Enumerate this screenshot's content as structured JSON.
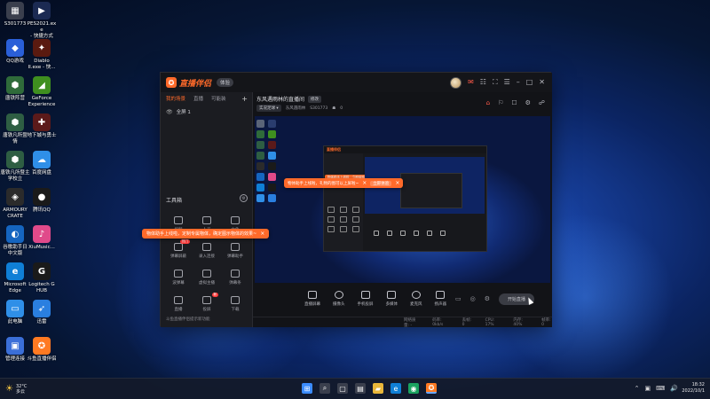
{
  "desktop": {
    "icons": [
      {
        "label": "S301773",
        "color": "#3a3f4d",
        "glyph": "▦"
      },
      {
        "label": "PES2021.exe\n- 快捷方式",
        "color": "#1b2a52",
        "glyph": "▶"
      },
      {
        "label": "QQ游戏",
        "color": "#2a5fd8",
        "glyph": "◆"
      },
      {
        "label": "Diablo\nII.exe - 快...",
        "color": "#5a1a10",
        "glyph": "✦"
      },
      {
        "label": "唐铁阵营",
        "color": "#2f6b3a",
        "glyph": "⬢"
      },
      {
        "label": "GeForce\nExperience",
        "color": "#3f8f1f",
        "glyph": "◢"
      },
      {
        "label": "唐铁凡所暨\n情",
        "color": "#2e5e43",
        "glyph": "⬢"
      },
      {
        "label": "地下城与勇士",
        "color": "#5b1a1a",
        "glyph": "✚"
      },
      {
        "label": "唐铁凡所暨主\n学校立",
        "color": "#2e5e43",
        "glyph": "⬢"
      },
      {
        "label": "百度网盘",
        "color": "#2f8fe8",
        "glyph": "☁"
      },
      {
        "label": "ARMOURY\nCRATE",
        "color": "#2b2b2b",
        "glyph": "◈"
      },
      {
        "label": "腾讯QQ",
        "color": "#1a1a1a",
        "glyph": "●"
      },
      {
        "label": "谷歌助手日\n中文版",
        "color": "#1565c0",
        "glyph": "◐"
      },
      {
        "label": "XiuMusic...",
        "color": "#e04a8a",
        "glyph": "♪"
      },
      {
        "label": "Microsoft\nEdge",
        "color": "#0f7fd6",
        "glyph": "e"
      },
      {
        "label": "Logitech G\nHUB",
        "color": "#1a1a1a",
        "glyph": "G"
      },
      {
        "label": "此电脑",
        "color": "#2f8fe8",
        "glyph": "▭"
      },
      {
        "label": "迅雷",
        "color": "#2a7fe0",
        "glyph": "➶"
      },
      {
        "label": "管理连接",
        "color": "#3b6fd8",
        "glyph": "▣"
      },
      {
        "label": "斗鱼直播伴侣",
        "color": "#ff7a22",
        "glyph": "✪"
      }
    ]
  },
  "app": {
    "logo_text": "直播伴侣",
    "version_badge": "体验",
    "title_icons": [
      "✉",
      "☷",
      "⛶",
      "☰",
      "–",
      "□",
      "✕"
    ],
    "tabs": [
      "我的场景",
      "直播",
      "可能装"
    ],
    "tab_plus": "+",
    "scene": {
      "eye": "👁",
      "name": "全屏 1"
    },
    "tools_title": "工具箱",
    "tools_gear": "⚙",
    "tools": [
      {
        "label": "视频",
        "badge": ""
      },
      {
        "label": "人员",
        "badge": ""
      },
      {
        "label": "文件",
        "badge": ""
      },
      {
        "label": "弹幕屏蔽",
        "badge": "热门"
      },
      {
        "label": "录入连接",
        "badge": ""
      },
      {
        "label": "弹幕助手",
        "badge": ""
      },
      {
        "label": "波弹幕",
        "badge": ""
      },
      {
        "label": "虚拟主播",
        "badge": ""
      },
      {
        "label": "弹幕条",
        "badge": ""
      },
      {
        "label": "直播",
        "badge": ""
      },
      {
        "label": "投屏",
        "badge": "新"
      },
      {
        "label": "下载",
        "badge": ""
      }
    ],
    "notice": "斗鱼直播伴侣提示新功能",
    "room_title": "东风遇雨林的直播间",
    "edit_label": "修改",
    "category": "实况足球 ▾",
    "room_name": "东风遇雨林",
    "room_id": "S301773",
    "viewer_icon": "☗",
    "viewer_count": "0",
    "head_icons": [
      "⌂",
      "⚐",
      "☐",
      "⚙",
      "☍"
    ],
    "toast_top": {
      "text": "物体助手上线啦，礼物的图可以上屏啦~",
      "pill": "立即体验",
      "close": "×"
    },
    "toast_bottom": {
      "text": "物体助手上线啦，定制专属物体，确定图示物体的效果~",
      "close": "×"
    },
    "nested_logo": "直播伴侣",
    "nested_toast": "物体助手上线啦 · 立即体验",
    "controls": [
      {
        "label": "直播屏幕",
        "round": false
      },
      {
        "label": "摄像头",
        "round": true
      },
      {
        "label": "手机投屏",
        "round": false
      },
      {
        "label": "多媒体",
        "round": false
      },
      {
        "label": "麦克风",
        "round": true
      },
      {
        "label": "扬声器",
        "round": false
      }
    ],
    "small_icons": [
      "▭",
      "◎",
      "⚙"
    ],
    "live_button": "开始直播",
    "status": [
      "网络质量: -",
      "码率: 0kb/s",
      "丢帧: 0",
      "CPU: 17%",
      "内存: 40%",
      "帧率: 0"
    ]
  },
  "taskbar": {
    "weather_temp": "32°C",
    "weather_desc": "多云",
    "weather_icon": "☀",
    "apps": [
      {
        "glyph": "⊞",
        "color": "#3b8cff",
        "active": false
      },
      {
        "glyph": "⌕",
        "color": "#3a3f4d",
        "active": false
      },
      {
        "glyph": "▢",
        "color": "#3a3f4d",
        "active": false
      },
      {
        "glyph": "▤",
        "color": "#3a3f4d",
        "active": false
      },
      {
        "glyph": "▰",
        "color": "#e9b73a",
        "active": false
      },
      {
        "glyph": "e",
        "color": "#0f7fd6",
        "active": false
      },
      {
        "glyph": "◉",
        "color": "#1aa260",
        "active": false
      },
      {
        "glyph": "✪",
        "color": "#ff7a22",
        "active": true
      }
    ],
    "tray_icons": [
      "⌃",
      "▣",
      "⌨",
      "🔊"
    ],
    "time": "18:32",
    "date": "2022/10/1"
  }
}
